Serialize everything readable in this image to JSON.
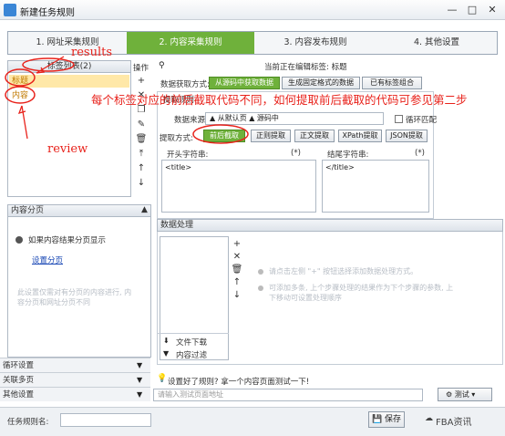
{
  "window": {
    "title": "新建任务规则"
  },
  "steps": [
    "1. 网址采集规则",
    "2. 内容采集规则",
    "3. 内容发布规则",
    "4. 其他设置"
  ],
  "left": {
    "taglist_header": "标签列表(2)",
    "ops_label": "操作",
    "tags": [
      "标题",
      "内容"
    ],
    "content_paging": {
      "header": "内容分页",
      "check_label": "如果内容结果分页显示",
      "link": "设置分页",
      "hint": "此设置仅需对有分页的内容进行, 内容分页和网址分页不同"
    },
    "bottom_items": [
      "循环设置",
      "关联多页",
      "其他设置"
    ]
  },
  "editing": {
    "label": "当前正在编辑标签: 标题"
  },
  "fetch_modes": {
    "label": "数据获取方式:",
    "options": [
      "从源码中获取数据",
      "生成固定格式的数据",
      "已有标签组合"
    ]
  },
  "extract": {
    "section": "提取规则",
    "source_label": "数据来源:",
    "source_value": "▲ 从默认页 ▲ 源码中",
    "loop_match": "循环匹配",
    "method_label": "提取方式:",
    "methods": [
      "前后截取",
      "正则提取",
      "正文提取",
      "XPath提取",
      "JSON提取"
    ],
    "start_label": "开头字符串:",
    "start_star": "(*)",
    "start_value": "<title>",
    "end_label": "结尾字符串:",
    "end_star": "(*)",
    "end_value": "</title>"
  },
  "processing": {
    "header": "数据处理",
    "hint1": "请点击左侧 \"+\" 按钮选择添加数据处理方式。",
    "hint2": "可添加多条, 上个步骤处理的结果作为下个步骤的参数, 上下移动可设置处理顺序",
    "actions": [
      "文件下载",
      "内容过滤"
    ]
  },
  "test": {
    "hint": "设置好了规则? 拿一个内容页面测试一下!",
    "placeholder": "请输入测试页面地址",
    "button": "测试"
  },
  "footer": {
    "name_label": "任务规则名:",
    "save": "保存",
    "watermark": "FBA资讯"
  },
  "annotations": {
    "results": "results",
    "review": "review",
    "note": "每个标签对应的前后截取代码不同，如何提取前后截取的代码可参见第二步"
  },
  "colors": {
    "accent_green": "#6fb13b",
    "annotation_red": "#e8221b"
  }
}
